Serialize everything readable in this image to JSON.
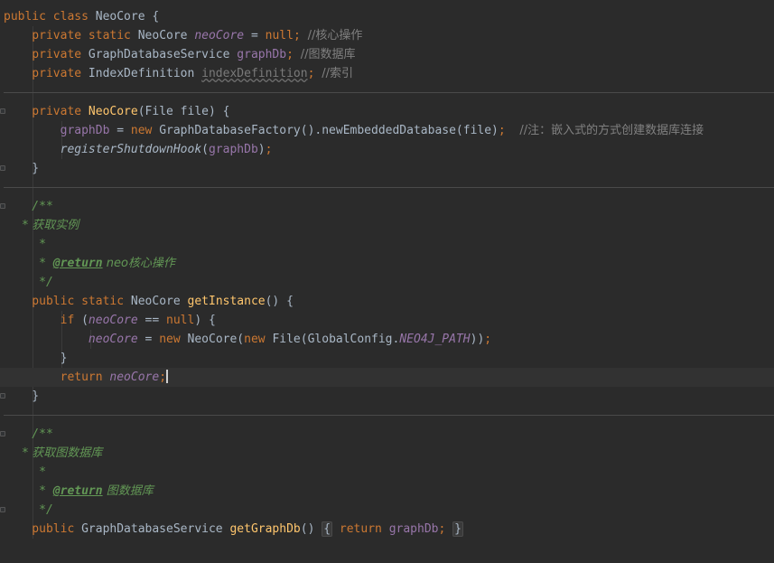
{
  "editor": {
    "lines": [
      {
        "id": "l-class",
        "tokens": [
          [
            "kw",
            "public class "
          ],
          [
            "plain",
            "NeoCore {"
          ]
        ]
      },
      {
        "id": "l-field1",
        "tokens": [
          [
            "kw",
            "    private static "
          ],
          [
            "plain",
            "NeoCore "
          ],
          [
            "sfld",
            "neoCore"
          ],
          [
            "plain",
            " = "
          ],
          [
            "kw",
            "null"
          ],
          [
            "kw",
            "; "
          ],
          [
            "cmt",
            "//核心操作"
          ]
        ]
      },
      {
        "id": "l-field2",
        "tokens": [
          [
            "kw",
            "    private "
          ],
          [
            "plain",
            "GraphDatabaseService "
          ],
          [
            "fld",
            "graphDb"
          ],
          [
            "kw",
            "; "
          ],
          [
            "cmt",
            "//图数据库"
          ]
        ]
      },
      {
        "id": "l-field3",
        "tokens": [
          [
            "kw",
            "    private "
          ],
          [
            "plain",
            "IndexDefinition "
          ],
          [
            "unused",
            "indexDefinition"
          ],
          [
            "kw",
            "; "
          ],
          [
            "cmt",
            "//索引"
          ]
        ]
      },
      {
        "id": "l-blank1",
        "tokens": []
      },
      {
        "id": "l-ctor",
        "tokens": [
          [
            "kw",
            "    private "
          ],
          [
            "fn",
            "NeoCore"
          ],
          [
            "plain",
            "(File file) {"
          ]
        ]
      },
      {
        "id": "l-ctor-body1",
        "tokens": [
          [
            "fld",
            "        graphDb"
          ],
          [
            "plain",
            " = "
          ],
          [
            "kw",
            "new "
          ],
          [
            "plain",
            "GraphDatabaseFactory().newEmbeddedDatabase(file)"
          ],
          [
            "kw",
            ";  "
          ],
          [
            "cmt",
            "//注：嵌入式的方式创建数据库连接"
          ]
        ]
      },
      {
        "id": "l-ctor-body2",
        "tokens": [
          [
            "ist",
            "        registerShutdownHook"
          ],
          [
            "plain",
            "("
          ],
          [
            "fld",
            "graphDb"
          ],
          [
            "plain",
            ")"
          ],
          [
            "kw",
            ";"
          ]
        ]
      },
      {
        "id": "l-ctor-close",
        "tokens": [
          [
            "plain",
            "    }"
          ]
        ]
      },
      {
        "id": "l-blank2",
        "tokens": []
      },
      {
        "id": "l-doc1-open",
        "tokens": [
          [
            "doc",
            "    /**"
          ]
        ]
      },
      {
        "id": "l-doc1-desc",
        "tokens": [
          [
            "doc",
            "     * 获取实例"
          ]
        ]
      },
      {
        "id": "l-doc1-star",
        "tokens": [
          [
            "doc",
            "     *"
          ]
        ]
      },
      {
        "id": "l-doc1-return",
        "tokens": [
          [
            "doc",
            "     * "
          ],
          [
            "tag",
            "@return"
          ],
          [
            "doc",
            " neo核心操作"
          ]
        ]
      },
      {
        "id": "l-doc1-close",
        "tokens": [
          [
            "doc",
            "     */"
          ]
        ]
      },
      {
        "id": "l-getinstance",
        "tokens": [
          [
            "kw",
            "    public static "
          ],
          [
            "plain",
            "NeoCore "
          ],
          [
            "fn",
            "getInstance"
          ],
          [
            "plain",
            "() {"
          ]
        ]
      },
      {
        "id": "l-if",
        "tokens": [
          [
            "kw",
            "        if "
          ],
          [
            "plain",
            "("
          ],
          [
            "sfld",
            "neoCore"
          ],
          [
            "plain",
            " == "
          ],
          [
            "kw",
            "null"
          ],
          [
            "plain",
            ") {"
          ]
        ]
      },
      {
        "id": "l-assign",
        "tokens": [
          [
            "sfld",
            "            neoCore"
          ],
          [
            "plain",
            " = "
          ],
          [
            "kw",
            "new "
          ],
          [
            "plain",
            "NeoCore("
          ],
          [
            "kw",
            "new "
          ],
          [
            "plain",
            "File(GlobalConfig."
          ],
          [
            "sfld",
            "NEO4J_PATH"
          ],
          [
            "plain",
            "))"
          ],
          [
            "kw",
            ";"
          ]
        ]
      },
      {
        "id": "l-if-close",
        "tokens": [
          [
            "plain",
            "        }"
          ]
        ]
      },
      {
        "id": "l-return",
        "tokens": [
          [
            "kw",
            "        return "
          ],
          [
            "sfld",
            "neoCore"
          ],
          [
            "kw",
            ";"
          ]
        ]
      },
      {
        "id": "l-getinstance-close",
        "tokens": [
          [
            "plain",
            "    }"
          ]
        ]
      },
      {
        "id": "l-blank3",
        "tokens": []
      },
      {
        "id": "l-doc2-open",
        "tokens": [
          [
            "doc",
            "    /**"
          ]
        ]
      },
      {
        "id": "l-doc2-desc",
        "tokens": [
          [
            "doc",
            "     * 获取图数据库"
          ]
        ]
      },
      {
        "id": "l-doc2-star",
        "tokens": [
          [
            "doc",
            "     *"
          ]
        ]
      },
      {
        "id": "l-doc2-return",
        "tokens": [
          [
            "doc",
            "     * "
          ],
          [
            "tag",
            "@return"
          ],
          [
            "doc",
            " 图数据库"
          ]
        ]
      },
      {
        "id": "l-doc2-close",
        "tokens": [
          [
            "doc",
            "     */"
          ]
        ]
      },
      {
        "id": "l-getgraphdb",
        "tokens": [
          [
            "kw",
            "    public "
          ],
          [
            "plain",
            "GraphDatabaseService "
          ],
          [
            "fn",
            "getGraphDb"
          ],
          [
            "plain",
            "() "
          ],
          [
            "foldbox",
            "{"
          ],
          [
            "plain",
            " "
          ],
          [
            "kw",
            "return "
          ],
          [
            "fld",
            "graphDb"
          ],
          [
            "kw",
            "; "
          ],
          [
            "foldbox",
            "}"
          ]
        ]
      }
    ],
    "caret_line_id": "l-return",
    "colors": {
      "background": "#2b2b2b",
      "keyword": "#cc7832",
      "field": "#9876aa",
      "method_decl": "#ffc66d",
      "comment": "#808080",
      "doc_comment": "#629755",
      "text": "#a9b7c6"
    }
  }
}
